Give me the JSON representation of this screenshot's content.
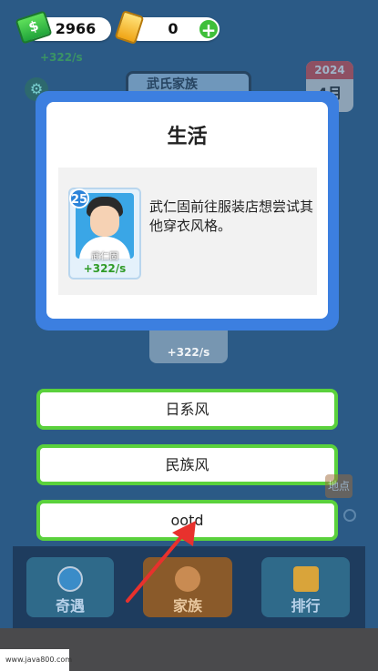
{
  "header": {
    "cash_amount": "2966",
    "gold_amount": "0",
    "add_symbol": "+",
    "income_text": "+322/s",
    "family_name": "武氏家族",
    "calendar_year": "2024",
    "calendar_month": "4月"
  },
  "modal": {
    "title": "生活",
    "member": {
      "level": "25",
      "name": "武仁固",
      "rate": "+322/s"
    },
    "event_text": "武仁固前往服装店想尝试其他穿衣风格。"
  },
  "background_card": {
    "rate": "+322/s"
  },
  "choices": [
    {
      "label": "日系风"
    },
    {
      "label": "民族风"
    },
    {
      "label": "ootd"
    }
  ],
  "side": {
    "tag": "地点"
  },
  "bottom_nav": [
    {
      "label": "奇遇",
      "icon": "compass-icon"
    },
    {
      "label": "家族",
      "icon": "family-icon"
    },
    {
      "label": "排行",
      "icon": "trophy-icon"
    }
  ],
  "watermark": "www.java800.com",
  "colors": {
    "accent_green": "#5ad13c",
    "modal_blue": "#3c7fe0",
    "app_bg": "#2b5a86",
    "arrow_red": "#e8312d"
  }
}
